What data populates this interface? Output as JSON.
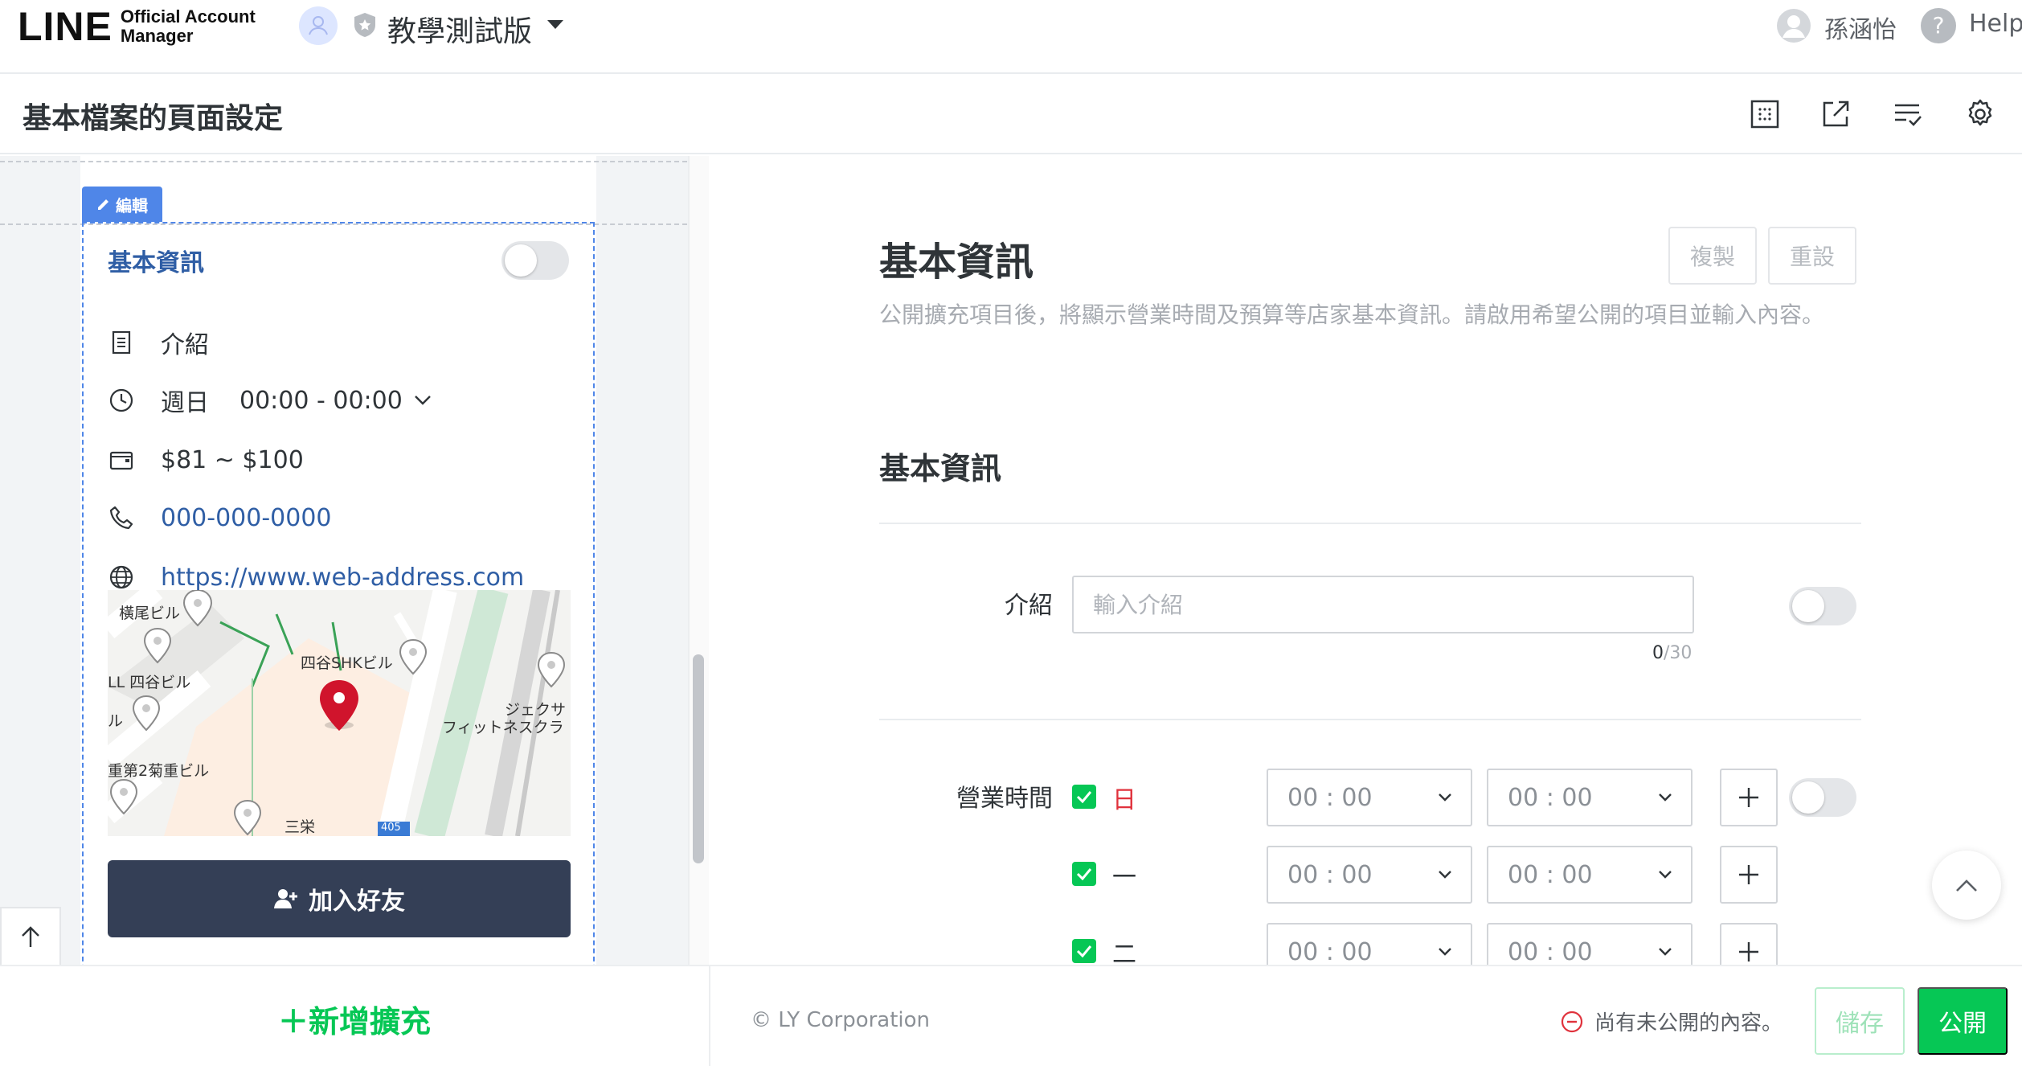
{
  "header": {
    "logo_main": "LINE",
    "logo_sub_1": "Official Account",
    "logo_sub_2": "Manager",
    "account_name": "教學測試版",
    "user_name": "孫涵怡",
    "help_label": "Help"
  },
  "page": {
    "title": "基本檔案的頁面設定"
  },
  "preview": {
    "edit_tag": "編輯",
    "card_title": "基本資訊",
    "intro": "介紹",
    "hours_day": "週日",
    "hours_time": "00:00 - 00:00",
    "budget": "$81 ~ $100",
    "phone": "000-000-0000",
    "url": "https://www.web-address.com",
    "map_labels": [
      "橫尾ビル",
      "四谷SHKビル",
      "LL 四谷ビル",
      "ル",
      "ジェクサ",
      "フィットネスクラ",
      "重第2菊重ビル",
      "三栄",
      "405"
    ],
    "add_friend": "加入好友"
  },
  "form": {
    "section_title": "基本資訊",
    "copy_label": "複製",
    "reset_label": "重設",
    "description": "公開擴充項目後，將顯示營業時間及預算等店家基本資訊。請啟用希望公開的項目並輸入內容。",
    "sub_title": "基本資訊",
    "intro_label": "介紹",
    "intro_placeholder": "輸入介紹",
    "intro_count": "0",
    "intro_max": "/30",
    "hours_label": "營業時間",
    "hours_rows": [
      {
        "day": "日",
        "start": "00 : 00",
        "end": "00 : 00"
      },
      {
        "day": "一",
        "start": "00 : 00",
        "end": "00 : 00"
      },
      {
        "day": "二",
        "start": "00 : 00",
        "end": "00 : 00"
      }
    ]
  },
  "footer": {
    "add_extension": "＋新增擴充",
    "copyright": "© LY Corporation",
    "warning": "尚有未公開的內容。",
    "save_label": "儲存",
    "publish_label": "公開"
  },
  "colors": {
    "brand_green": "#06c755",
    "link_blue": "#2f5ea5",
    "edit_blue": "#4f86e8",
    "dark_button": "#343f56",
    "sunday_red": "#e0323c",
    "warning_red": "#e0323c"
  }
}
